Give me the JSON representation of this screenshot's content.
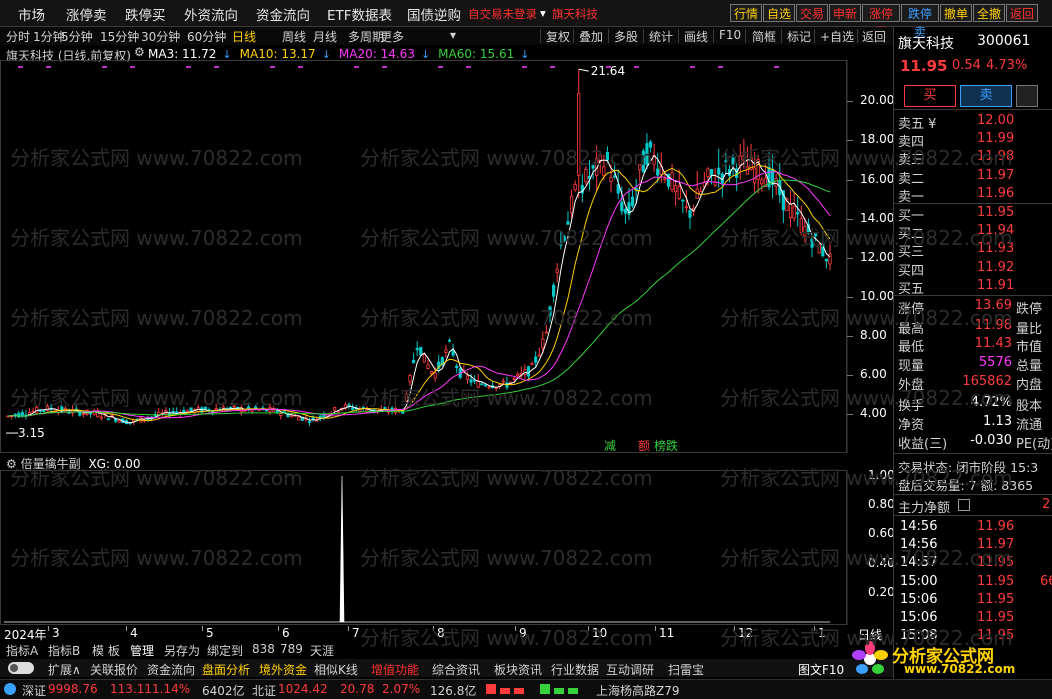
{
  "menu": {
    "items": [
      "市场",
      "涨停卖",
      "跌停买",
      "外资流向",
      "资金流向",
      "ETF数据表",
      "国债逆购"
    ],
    "warning": "自交易未登录",
    "stock_link": "旗天科技",
    "right_buttons": [
      {
        "label": "行情",
        "color": "#ffd000"
      },
      {
        "label": "自选",
        "color": "#ffd000"
      },
      {
        "label": "交易",
        "color": "#ff3030"
      },
      {
        "label": "申新",
        "color": "#ff3030"
      },
      {
        "label": "涨停买",
        "color": "#ff3030"
      },
      {
        "label": "跌停卖",
        "color": "#3aa0ff"
      },
      {
        "label": "撤单",
        "color": "#ffd000"
      },
      {
        "label": "全撤",
        "color": "#ffd000"
      },
      {
        "label": "返回",
        "color": "#ff3030"
      }
    ]
  },
  "periods": [
    "分时",
    "1分钟",
    "5分钟",
    "15分钟",
    "30分钟",
    "60分钟",
    "日线",
    "周线",
    "月线",
    "多周期",
    "更多"
  ],
  "active_period": "日线",
  "tools": [
    "复权",
    "叠加",
    "多股",
    "统计",
    "画线",
    "F10",
    "简框",
    "标记",
    "+自选",
    "返回"
  ],
  "chart_header": {
    "name": "旗天科技 (日线,前复权)",
    "ma": [
      {
        "label": "MA3: 11.72",
        "color": "#ffffff"
      },
      {
        "label": "MA10: 13.17",
        "color": "#ffd000"
      },
      {
        "label": "MA20: 14.63",
        "color": "#ff38ff"
      },
      {
        "label": "MA60: 15.61",
        "color": "#35d23a"
      }
    ]
  },
  "annotations": {
    "high": "21.64",
    "low": "3.15",
    "signal_1": "减",
    "signal_2": "额",
    "signal_3": "榜跌"
  },
  "indicator": {
    "name": "倍量擒牛副",
    "value": "XG: 0.00"
  },
  "chart_data": [
    {
      "type": "candlestick",
      "title": "旗天科技 (日线,前复权)",
      "ylim": [
        3,
        21.64
      ],
      "y_ticks": [
        4.0,
        6.0,
        8.0,
        10.0,
        12.0,
        14.0,
        16.0,
        18.0,
        20.0
      ],
      "x_ticks": [
        "2024年",
        "3",
        "4",
        "5",
        "6",
        "7",
        "8",
        "9",
        "10",
        "11",
        "12",
        "1"
      ],
      "high": 21.64,
      "low": 3.15,
      "series": [
        {
          "name": "MA3",
          "color": "#ffffff",
          "last": 11.72
        },
        {
          "name": "MA10",
          "color": "#ffd000",
          "last": 13.17
        },
        {
          "name": "MA20",
          "color": "#ff38ff",
          "last": 14.63
        },
        {
          "name": "MA60",
          "color": "#35d23a",
          "last": 15.61
        }
      ]
    },
    {
      "type": "bar",
      "title": "倍量擒牛副",
      "ylim": [
        0,
        1
      ],
      "y_ticks": [
        0.2,
        0.4,
        0.6,
        0.8,
        1.0
      ],
      "signal_month": "7",
      "value": 0
    }
  ],
  "quote": {
    "name": "旗天科技",
    "code": "300061",
    "price": "11.95",
    "change": "0.54",
    "pct": "4.73%",
    "buy_label": "买",
    "sell_label": "卖",
    "asks": [
      {
        "label": "卖五 ¥",
        "price": "12.00"
      },
      {
        "label": "卖四",
        "price": "11.99"
      },
      {
        "label": "卖三",
        "price": "11.98"
      },
      {
        "label": "卖二",
        "price": "11.97"
      },
      {
        "label": "卖一",
        "price": "11.96"
      }
    ],
    "bids": [
      {
        "label": "买一",
        "price": "11.95"
      },
      {
        "label": "买二",
        "price": "11.94"
      },
      {
        "label": "买三",
        "price": "11.93"
      },
      {
        "label": "买四",
        "price": "11.92"
      },
      {
        "label": "买五",
        "price": "11.91"
      }
    ],
    "stats": [
      {
        "label": "涨停",
        "value": "13.69",
        "color": "#ff3b3b",
        "label2": "跌停"
      },
      {
        "label": "最高",
        "value": "11.98",
        "color": "#ff3b3b",
        "label2": "量比"
      },
      {
        "label": "最低",
        "value": "11.43",
        "color": "#ff3b3b",
        "label2": "市值"
      },
      {
        "label": "现量",
        "value": "5576",
        "color": "#ff38ff",
        "label2": "总量"
      },
      {
        "label": "外盘",
        "value": "165862",
        "color": "#ff3b3b",
        "label2": "内盘"
      },
      {
        "label": "换手",
        "value": "4.72%",
        "color": "#ffffff",
        "label2": "股本"
      },
      {
        "label": "净资",
        "value": "1.13",
        "color": "#ffffff",
        "label2": "流通"
      },
      {
        "label": "收益(三)",
        "value": "-0.030",
        "color": "#ffffff",
        "label2": "PE(动)"
      }
    ],
    "trade_status": "交易状态: 闭市阶段 15:3",
    "after_hours": "盘后交易量: 7  额: 8365",
    "main_flow": "主力净额",
    "ticks": [
      {
        "time": "14:56",
        "price": "11.96",
        "vol": ""
      },
      {
        "time": "14:56",
        "price": "11.97",
        "vol": ""
      },
      {
        "time": "14:57",
        "price": "11.95",
        "vol": ""
      },
      {
        "time": "15:00",
        "price": "11.95",
        "vol": "66"
      },
      {
        "time": "15:06",
        "price": "11.95",
        "vol": ""
      },
      {
        "time": "15:06",
        "price": "11.95",
        "vol": ""
      },
      {
        "time": "15:08",
        "price": "11.95",
        "vol": ""
      }
    ],
    "period_label": "日线"
  },
  "bottom_tabs": [
    "指标A",
    "指标B",
    "模 板",
    "管理",
    "另存为",
    "绑定到",
    "838",
    "789",
    "天涯"
  ],
  "func_tabs": [
    "扩展∧",
    "关联报价",
    "资金流向",
    "盘面分析",
    "境外资金",
    "相似K线",
    "增值功能",
    "综合资讯",
    "板块资讯",
    "行业数据",
    "互动调研",
    "扫雷宝"
  ],
  "func_right": "图文F10",
  "status_bar": {
    "sz_label": "深证",
    "sz_val": "9998.76",
    "sz_chg": "113.11",
    "sz_pct": "1.14%",
    "sz_amt": "6402亿",
    "bz_label": "北证",
    "bz_val": "1024.42",
    "bz_chg": "20.78",
    "bz_pct": "2.07%",
    "bz_amt": "126.8亿",
    "news": "上海杨高路Z79"
  },
  "logo": {
    "text": "分析家公式网",
    "url": "www.70822.com"
  },
  "watermark": "分析家公式网 www.70822.com"
}
